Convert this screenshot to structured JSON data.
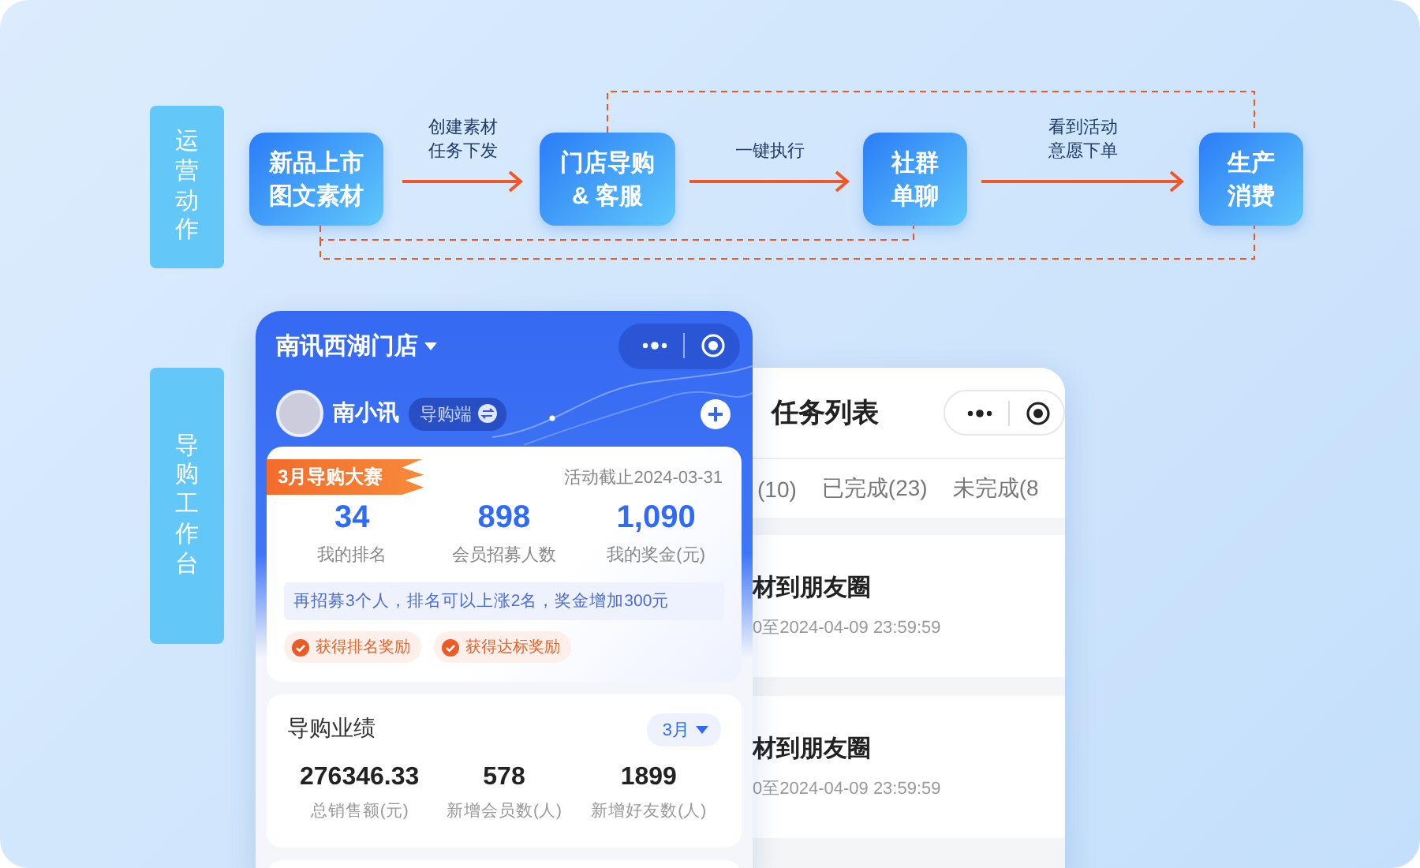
{
  "side_labels": [
    {
      "text": "运营动作"
    },
    {
      "text": "导购工作台"
    }
  ],
  "flow": {
    "nodes": [
      {
        "lines": [
          "新品上市",
          "图文素材"
        ]
      },
      {
        "lines": [
          "门店导购",
          "& 客服"
        ]
      },
      {
        "lines": [
          "社群",
          "单聊"
        ]
      },
      {
        "lines": [
          "生产",
          "消费"
        ]
      }
    ],
    "arrows": [
      {
        "lines": [
          "创建素材",
          "任务下发"
        ]
      },
      {
        "lines": [
          "一键执行"
        ]
      },
      {
        "lines": [
          "看到活动",
          "意愿下单"
        ]
      }
    ]
  },
  "task_phone": {
    "title": "任务列表",
    "tabs": [
      {
        "label": "(10)",
        "selected": false
      },
      {
        "label": "已完成(23)",
        "selected": false
      },
      {
        "label": "未完成(8",
        "selected": false
      }
    ],
    "tasks": [
      {
        "title": "材到朋友圈",
        "time": "0至2024-04-09 23:59:59"
      },
      {
        "title": "材到朋友圈",
        "time": "0至2024-04-09 23:59:59"
      }
    ]
  },
  "guide_phone": {
    "store": "南讯西湖门店",
    "user": {
      "name": "南小讯",
      "role": "导购端"
    },
    "contest": {
      "title": "3月导购大赛",
      "deadline": "活动截止2024-03-31",
      "stats": [
        {
          "value": "34",
          "label": "我的排名"
        },
        {
          "value": "898",
          "label": "会员招募人数"
        },
        {
          "value": "1,090",
          "label": "我的奖金(元)"
        }
      ],
      "tip": "再招募3个人，排名可以上涨2名，奖金增加300元",
      "rewards": [
        "获得排名奖励",
        "获得达标奖励"
      ]
    },
    "performance": {
      "title": "导购业绩",
      "period": "3月",
      "stats": [
        {
          "value": "276346.33",
          "label": "总销售额(元)"
        },
        {
          "value": "578",
          "label": "新增会员数(人)"
        },
        {
          "value": "1899",
          "label": "新增好友数(人)"
        }
      ]
    }
  }
}
